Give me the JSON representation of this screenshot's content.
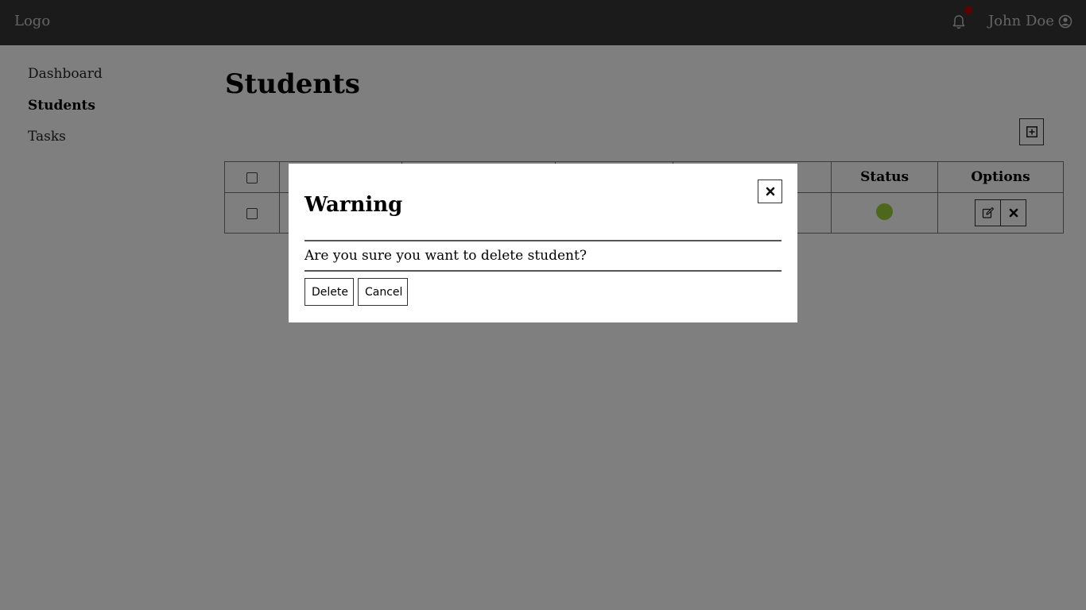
{
  "header": {
    "logo": "Logo",
    "username": "John Doe",
    "has_notification": true
  },
  "sidebar": {
    "items": [
      {
        "label": "Dashboard",
        "active": false
      },
      {
        "label": "Students",
        "active": true
      },
      {
        "label": "Tasks",
        "active": false
      }
    ]
  },
  "main": {
    "title": "Students",
    "table": {
      "columns": [
        "",
        "",
        "",
        "",
        "",
        "Status",
        "Options"
      ],
      "rows": [
        {
          "status_color": "#9ad13a"
        }
      ]
    }
  },
  "modal": {
    "title": "Warning",
    "message": "Are you sure you want to delete student?",
    "delete_label": "Delete",
    "cancel_label": "Cancel"
  },
  "colors": {
    "header_bg": "#373737",
    "status_active": "#9ad13a",
    "notification_dot": "#c00000"
  }
}
